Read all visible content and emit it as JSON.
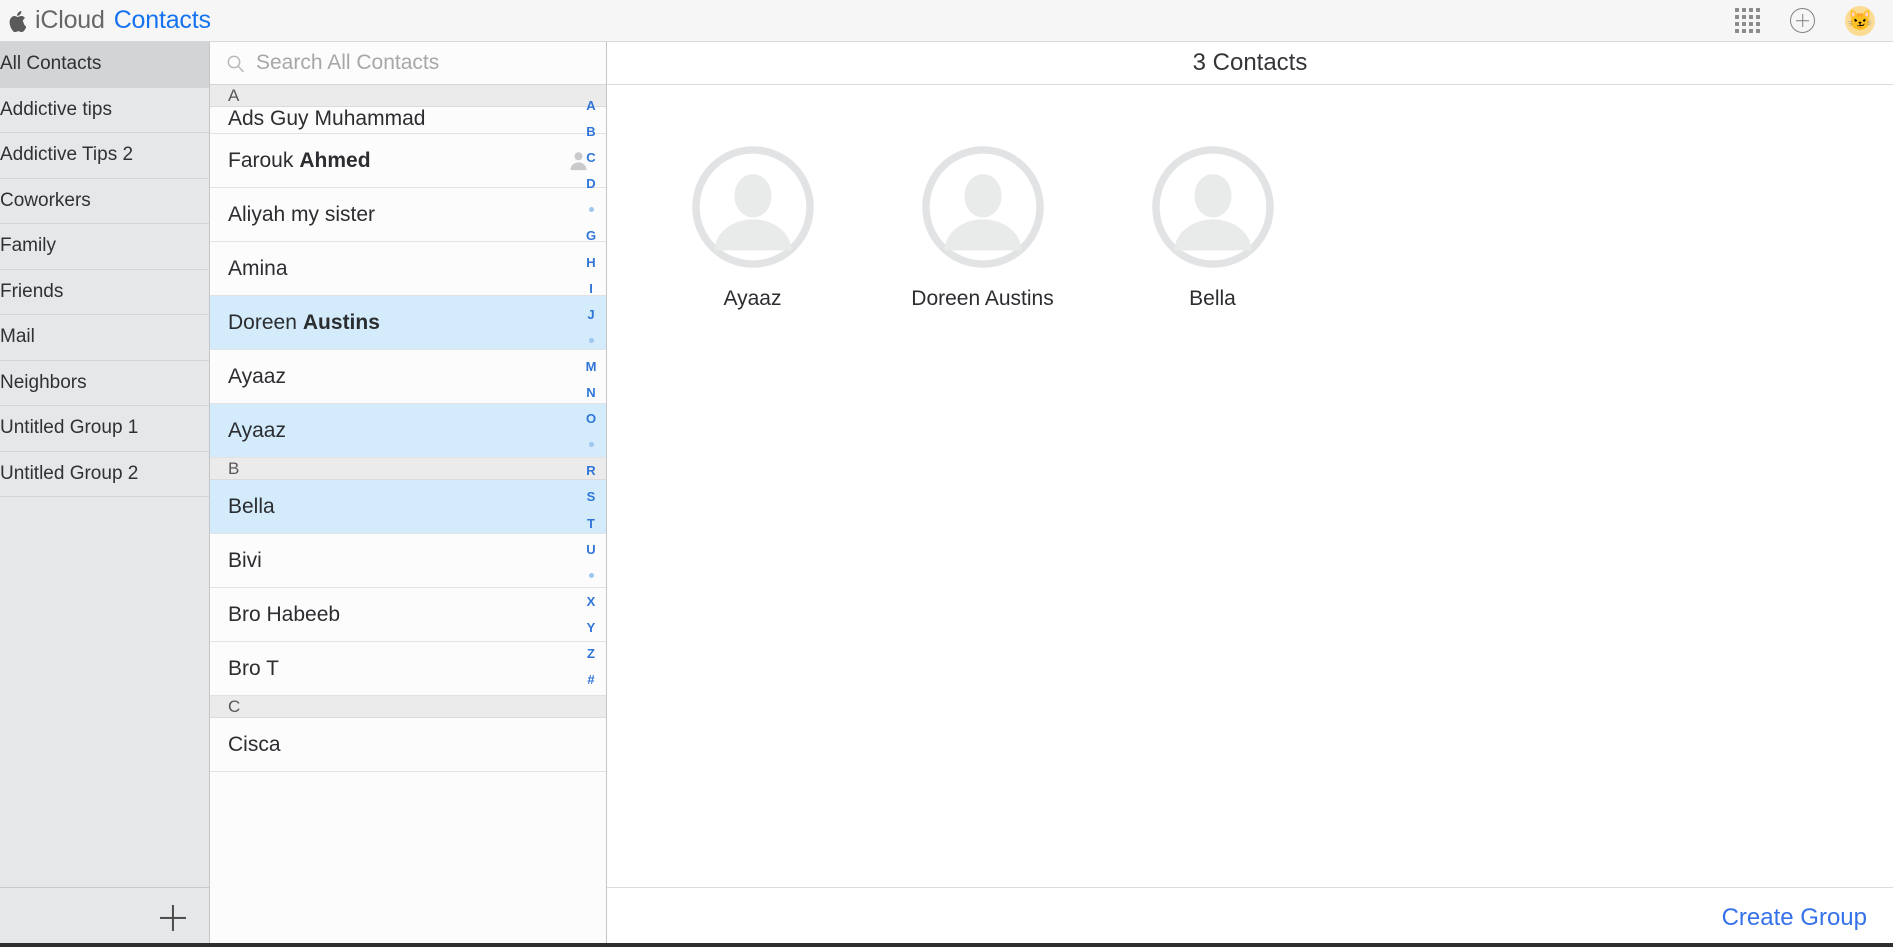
{
  "header": {
    "icloud_label": "iCloud",
    "app_label": "Contacts",
    "apple_logo_icon": "apple-logo-icon",
    "apps_grid_icon": "apps-grid-icon",
    "add_icon": "plus-circle-icon",
    "avatar_emoji": "😼",
    "avatar_bg": "#fcdc94",
    "accent_blue": "#1673f0"
  },
  "sidebar": {
    "items": [
      {
        "label": "All Contacts",
        "selected": true
      },
      {
        "label": "Addictive tips",
        "selected": false
      },
      {
        "label": "Addictive Tips 2",
        "selected": false
      },
      {
        "label": "Coworkers",
        "selected": false
      },
      {
        "label": "Family",
        "selected": false
      },
      {
        "label": "Friends",
        "selected": false
      },
      {
        "label": "Mail",
        "selected": false
      },
      {
        "label": "Neighbors",
        "selected": false
      },
      {
        "label": "Untitled Group 1",
        "selected": false
      },
      {
        "label": "Untitled Group 2",
        "selected": false
      }
    ],
    "footer": {
      "settings_icon": "gear-icon",
      "add_group_icon": "plus-icon"
    }
  },
  "search": {
    "placeholder": "Search All Contacts",
    "value": "",
    "icon": "search-icon"
  },
  "contact_list": {
    "entries": [
      {
        "kind": "section",
        "label": "A"
      },
      {
        "kind": "contact",
        "first": "Ads Guy",
        "last": "Muhammad",
        "bold_last": false,
        "selected": false,
        "clipped": true
      },
      {
        "kind": "contact",
        "first": "Farouk",
        "last": "Ahmed",
        "bold_last": true,
        "selected": false,
        "has_person_icon": true
      },
      {
        "kind": "contact",
        "first": "Aliyah my sister",
        "last": "",
        "bold_last": false,
        "selected": false
      },
      {
        "kind": "contact",
        "first": "Amina",
        "last": "",
        "bold_last": false,
        "selected": false
      },
      {
        "kind": "contact",
        "first": "Doreen",
        "last": "Austins",
        "bold_last": true,
        "selected": true
      },
      {
        "kind": "contact",
        "first": "Ayaaz",
        "last": "",
        "bold_last": false,
        "selected": false
      },
      {
        "kind": "contact",
        "first": "Ayaaz",
        "last": "",
        "bold_last": false,
        "selected": true
      },
      {
        "kind": "section",
        "label": "B"
      },
      {
        "kind": "contact",
        "first": "Bella",
        "last": "",
        "bold_last": false,
        "selected": true
      },
      {
        "kind": "contact",
        "first": "Bivi",
        "last": "",
        "bold_last": false,
        "selected": false
      },
      {
        "kind": "contact",
        "first": "Bro Habeeb",
        "last": "",
        "bold_last": false,
        "selected": false
      },
      {
        "kind": "contact",
        "first": "Bro T",
        "last": "",
        "bold_last": false,
        "selected": false
      },
      {
        "kind": "section",
        "label": "C"
      },
      {
        "kind": "contact",
        "first": "Cisca",
        "last": "",
        "bold_last": false,
        "selected": false
      }
    ],
    "alpha_index": [
      "A",
      "B",
      "C",
      "D",
      "•",
      "G",
      "H",
      "I",
      "J",
      "•",
      "M",
      "N",
      "O",
      "•",
      "R",
      "S",
      "T",
      "U",
      "•",
      "X",
      "Y",
      "Z",
      "#"
    ],
    "selected_row_color": "#d3ebfa"
  },
  "detail": {
    "count_label": "3 Contacts",
    "cards": [
      {
        "name": "Ayaaz",
        "avatar_icon": "person-placeholder-icon"
      },
      {
        "name": "Doreen Austins",
        "avatar_icon": "person-placeholder-icon"
      },
      {
        "name": "Bella",
        "avatar_icon": "person-placeholder-icon"
      }
    ],
    "create_group_label": "Create Group",
    "create_group_color": "#3571e8"
  }
}
